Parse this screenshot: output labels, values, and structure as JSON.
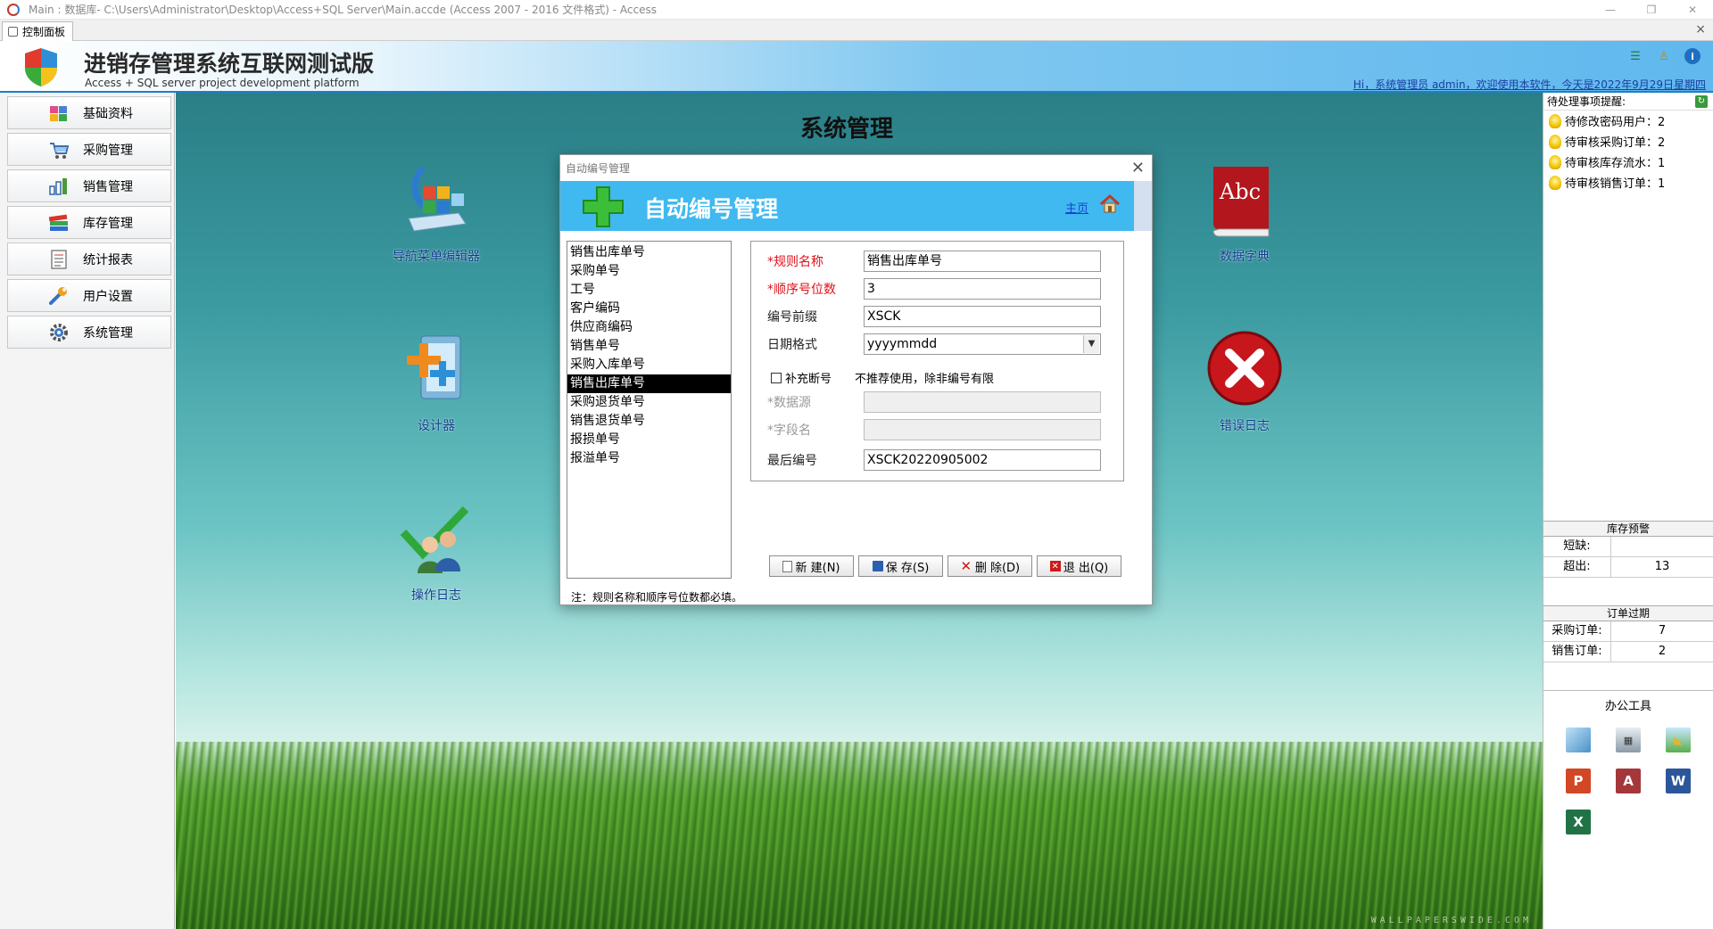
{
  "window": {
    "title": "Main : 数据库- C:\\Users\\Administrator\\Desktop\\Access+SQL Server\\Main.accde (Access 2007 - 2016 文件格式) - Access",
    "minimize": "—",
    "restore": "❐",
    "close": "✕"
  },
  "tab": {
    "label": "控制面板",
    "close": "×"
  },
  "header": {
    "title": "进销存管理系统互联网测试版",
    "subtitle": "Access + SQL server project development platform",
    "greeting": "Hi，系统管理员 admin，欢迎使用本软件，今天是2022年9月29日星期四",
    "icons": [
      "list-icon",
      "user-icon",
      "info-icon"
    ]
  },
  "sidebar": {
    "items": [
      {
        "label": "基础资料",
        "icon": "base-data-icon"
      },
      {
        "label": "采购管理",
        "icon": "purchase-cart-icon"
      },
      {
        "label": "销售管理",
        "icon": "sales-chart-icon"
      },
      {
        "label": "库存管理",
        "icon": "inventory-books-icon"
      },
      {
        "label": "统计报表",
        "icon": "report-document-icon"
      },
      {
        "label": "用户设置",
        "icon": "wrench-icon"
      },
      {
        "label": "系统管理",
        "icon": "gear-icon"
      }
    ]
  },
  "main": {
    "title": "系统管理",
    "watermark": "WALLPAPERSWIDE.COM",
    "shortcuts": {
      "nav_editor": "导航菜单编辑器",
      "designer": "设计器",
      "operation_log": "操作日志",
      "data_dictionary": "数据字典",
      "dictionary_icon_text": "Abc",
      "error_log": "错误日志"
    }
  },
  "right_panel": {
    "todo_header": "待处理事项提醒:",
    "todos": [
      "待修改密码用户：2",
      "待审核采购订单：2",
      "待审核库存流水：1",
      "待审核销售订单：1"
    ],
    "stock_warning": {
      "caption": "库存预警",
      "rows": [
        {
          "label": "短缺:",
          "value": ""
        },
        {
          "label": "超出:",
          "value": "13"
        }
      ]
    },
    "order_expired": {
      "caption": "订单过期",
      "rows": [
        {
          "label": "采购订单:",
          "value": "7"
        },
        {
          "label": "销售订单:",
          "value": "2"
        }
      ]
    },
    "office_tools": {
      "caption": "办公工具",
      "items": [
        {
          "icon": "notebook-icon",
          "text": "",
          "color": "#4a90c8"
        },
        {
          "icon": "calculator-icon",
          "text": "",
          "color": "#8a9aa8"
        },
        {
          "icon": "picture-icon",
          "text": "",
          "color": "#5cae4c"
        },
        {
          "icon": "powerpoint-icon",
          "text": "P",
          "color": "#d24726"
        },
        {
          "icon": "access-icon",
          "text": "A",
          "color": "#a4373a"
        },
        {
          "icon": "word-icon",
          "text": "W",
          "color": "#2b579a"
        },
        {
          "icon": "excel-icon",
          "text": "X",
          "color": "#217346"
        }
      ]
    }
  },
  "dialog": {
    "window_title": "自动编号管理",
    "banner_title": "自动编号管理",
    "home_link": "主页",
    "close": "✕",
    "rules": [
      "销售出库单号",
      "采购单号",
      "工号",
      "客户编码",
      "供应商编码",
      "销售单号",
      "采购入库单号",
      "销售出库单号",
      "采购退货单号",
      "销售退货单号",
      "报损单号",
      "报溢单号"
    ],
    "selected_rule_index": 7,
    "form": {
      "rule_name_label": "*规则名称",
      "rule_name": "销售出库单号",
      "seq_digits_label": "*顺序号位数",
      "seq_digits": "3",
      "prefix_label": "编号前缀",
      "prefix": "XSCK",
      "date_format_label": "日期格式",
      "date_format": "yyyymmdd",
      "fill_gap_label": "补充断号",
      "fill_gap_hint": "不推荐使用，除非编号有限",
      "fill_gap_checked": false,
      "datasource_label": "*数据源",
      "datasource": "",
      "field_label": "*字段名",
      "field": "",
      "last_number_label": "最后编号",
      "last_number": "XSCK20220905002"
    },
    "buttons": {
      "new": "新 建(N)",
      "save": "保 存(S)",
      "delete": "删 除(D)",
      "exit": "退 出(Q)"
    },
    "note": "注：规则名称和顺序号位数都必填。",
    "colors": {
      "banner": "#3fb9ef",
      "required": "#e0101a",
      "selected_row": "#000000"
    }
  }
}
